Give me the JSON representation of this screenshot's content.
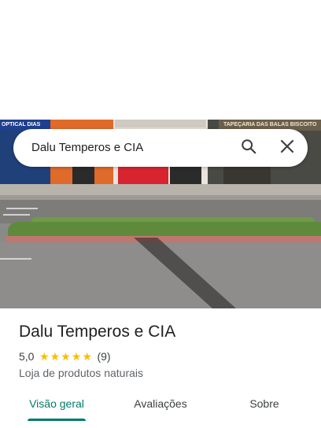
{
  "search": {
    "query": "Dalu Temperos e CIA",
    "search_icon": "search-icon",
    "close_icon": "close-icon"
  },
  "photo": {
    "sign_left": "OPTICAL DIAS",
    "sign_right": "TAPEÇARIA DAS BALAS BISCOITO"
  },
  "place": {
    "title": "Dalu Temperos e CIA",
    "rating": "5,0",
    "stars": 5,
    "review_count": "(9)",
    "category": "Loja de produtos naturais"
  },
  "tabs": [
    {
      "label": "Visão geral",
      "active": true
    },
    {
      "label": "Avaliações",
      "active": false
    },
    {
      "label": "Sobre",
      "active": false
    }
  ],
  "colors": {
    "accent": "#00796b",
    "star": "#fbbc04"
  }
}
